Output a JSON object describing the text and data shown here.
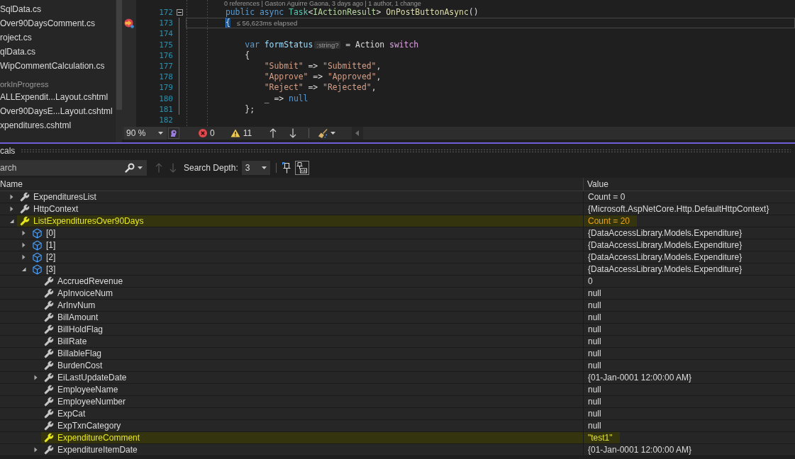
{
  "solution_explorer": {
    "items": [
      {
        "kind": "file",
        "label": "SqlData.cs"
      },
      {
        "kind": "file",
        "label": "Over90DaysComment.cs"
      },
      {
        "kind": "file",
        "label": "roject.cs"
      },
      {
        "kind": "file",
        "label": "qlData.cs"
      },
      {
        "kind": "file",
        "label": "WipCommentCalculation.cs"
      },
      {
        "kind": "folder",
        "label": "orkInProgress"
      },
      {
        "kind": "file",
        "label": "ALLExpendit...Layout.cshtml"
      },
      {
        "kind": "file",
        "label": "Over90DaysE...Layout.cshtml"
      },
      {
        "kind": "file",
        "label": "xpenditures.cshtml"
      }
    ]
  },
  "editor": {
    "codelens": "0 references | Gaston Aguirre Gaona, 3 days ago | 1 author, 1 change",
    "lines": [
      {
        "number": "172",
        "fold": true,
        "current": false,
        "tokens": [
          {
            "kind": "keyword",
            "text": "        public async "
          },
          {
            "kind": "type",
            "text": "Task"
          },
          {
            "kind": "plain",
            "text": "<"
          },
          {
            "kind": "interface",
            "text": "IActionResult"
          },
          {
            "kind": "plain",
            "text": "> "
          },
          {
            "kind": "method",
            "text": "OnPostButtonAsync"
          },
          {
            "kind": "plain",
            "text": "()"
          }
        ]
      },
      {
        "number": "173",
        "fold": false,
        "current": true,
        "tokens": [
          {
            "kind": "highlight",
            "text": "        {"
          }
        ],
        "perf_tip": "≤ 56,623ms elapsed"
      },
      {
        "number": "174",
        "fold": false,
        "current": false
      },
      {
        "number": "175",
        "fold": false,
        "current": false,
        "tokens": [
          {
            "kind": "keyword",
            "text": "            var "
          },
          {
            "kind": "variable",
            "text": "formStatus"
          },
          {
            "kind": "hint",
            "text": ":string?"
          },
          {
            "kind": "plain",
            "text": " = Action "
          },
          {
            "kind": "control",
            "text": "switch"
          }
        ]
      },
      {
        "number": "176",
        "fold": false,
        "current": false,
        "tokens": [
          {
            "kind": "plain",
            "text": "            {"
          }
        ]
      },
      {
        "number": "177",
        "fold": false,
        "current": false,
        "tokens": [
          {
            "kind": "string",
            "text": "                \"Submit\""
          },
          {
            "kind": "plain",
            "text": " => "
          },
          {
            "kind": "string",
            "text": "\"Submitted\""
          },
          {
            "kind": "plain",
            "text": ","
          }
        ]
      },
      {
        "number": "178",
        "fold": false,
        "current": false,
        "tokens": [
          {
            "kind": "string",
            "text": "                \"Approve\""
          },
          {
            "kind": "plain",
            "text": " => "
          },
          {
            "kind": "string",
            "text": "\"Approved\""
          },
          {
            "kind": "plain",
            "text": ","
          }
        ]
      },
      {
        "number": "179",
        "fold": false,
        "current": false,
        "tokens": [
          {
            "kind": "string",
            "text": "                \"Reject\""
          },
          {
            "kind": "plain",
            "text": " => "
          },
          {
            "kind": "string",
            "text": "\"Rejected\""
          },
          {
            "kind": "plain",
            "text": ","
          }
        ]
      },
      {
        "number": "180",
        "fold": false,
        "current": false,
        "tokens": [
          {
            "kind": "plain",
            "text": "                _ => "
          },
          {
            "kind": "keyword",
            "text": "null"
          }
        ]
      },
      {
        "number": "181",
        "fold": false,
        "current": false,
        "tokens": [
          {
            "kind": "plain",
            "text": "            };"
          }
        ]
      },
      {
        "number": "182",
        "fold": false,
        "current": false
      }
    ],
    "toolbar": {
      "zoom": "90 %",
      "errors": "0",
      "warnings": "11",
      "nav": [
        {
          "kind": "up",
          "disabled": false
        },
        {
          "kind": "down",
          "disabled": false
        }
      ]
    }
  },
  "locals": {
    "title": "cals",
    "search": {
      "placeholder": "arch"
    },
    "search_nav": [
      {
        "kind": "up",
        "disabled": true
      },
      {
        "kind": "down",
        "disabled": true
      }
    ],
    "search_depth": {
      "label": "Search Depth:",
      "value": "3"
    },
    "pins": [
      {
        "kind": "pin",
        "on": false
      },
      {
        "kind": "pin-text",
        "on": true
      }
    ],
    "columns": [
      "Name",
      "Value"
    ],
    "rows": [
      {
        "name": "ExpendituresList",
        "value": "Count = 0",
        "kind": "property",
        "expanded": false,
        "highlighted": false
      },
      {
        "name": "HttpContext",
        "value": "{Microsoft.AspNetCore.Http.DefaultHttpContext}",
        "kind": "property",
        "expanded": false,
        "highlighted": false
      },
      {
        "name": "ListExpendituresOver90Days",
        "value": "Count = 20",
        "kind": "property",
        "expanded": true,
        "highlighted": true,
        "color": "#e8a317",
        "children": [
          {
            "name": "[0]",
            "value": "{DataAccessLibrary.Models.Expenditure}",
            "kind": "object",
            "expanded": false,
            "highlighted": false
          },
          {
            "name": "[1]",
            "value": "{DataAccessLibrary.Models.Expenditure}",
            "kind": "object",
            "expanded": false,
            "highlighted": false
          },
          {
            "name": "[2]",
            "value": "{DataAccessLibrary.Models.Expenditure}",
            "kind": "object",
            "expanded": false,
            "highlighted": false
          },
          {
            "name": "[3]",
            "value": "{DataAccessLibrary.Models.Expenditure}",
            "kind": "object",
            "expanded": true,
            "highlighted": false,
            "children": [
              {
                "name": "AccruedRevenue",
                "value": "0",
                "kind": "property",
                "highlighted": false
              },
              {
                "name": "ApInvoiceNum",
                "value": "null",
                "kind": "property",
                "highlighted": false
              },
              {
                "name": "ArInvNum",
                "value": "null",
                "kind": "property",
                "highlighted": false
              },
              {
                "name": "BillAmount",
                "value": "null",
                "kind": "property",
                "highlighted": false
              },
              {
                "name": "BillHoldFlag",
                "value": "null",
                "kind": "property",
                "highlighted": false
              },
              {
                "name": "BillRate",
                "value": "null",
                "kind": "property",
                "highlighted": false
              },
              {
                "name": "BillableFlag",
                "value": "null",
                "kind": "property",
                "highlighted": false
              },
              {
                "name": "BurdenCost",
                "value": "null",
                "kind": "property",
                "highlighted": false
              },
              {
                "name": "EiLastUpdateDate",
                "value": "{01-Jan-0001 12:00:00 AM}",
                "kind": "property",
                "expanded": false,
                "highlighted": false
              },
              {
                "name": "EmployeeName",
                "value": "null",
                "kind": "property",
                "highlighted": false
              },
              {
                "name": "EmployeeNumber",
                "value": "null",
                "kind": "property",
                "highlighted": false
              },
              {
                "name": "ExpCat",
                "value": "null",
                "kind": "property",
                "highlighted": false
              },
              {
                "name": "ExpTxnCategory",
                "value": "null",
                "kind": "property",
                "highlighted": false
              },
              {
                "name": "ExpenditureComment",
                "value": "\"test1\"",
                "kind": "property",
                "highlighted": true,
                "color": "#e2e23a"
              },
              {
                "name": "ExpenditureItemDate",
                "value": "{01-Jan-0001 12:00:00 AM}",
                "kind": "property",
                "expanded": false,
                "highlighted": false
              }
            ]
          }
        ]
      }
    ]
  }
}
